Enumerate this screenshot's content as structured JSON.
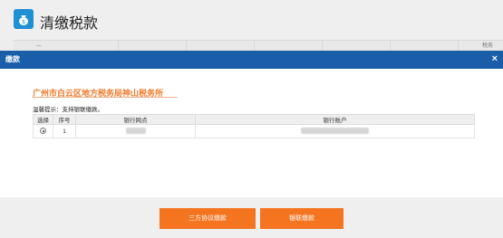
{
  "page": {
    "title": "清缴税款",
    "strip_left_text": "一",
    "strip_right_text": "税务"
  },
  "modal": {
    "title": "缴款",
    "close_glyph": "×",
    "org_name": "广州市白云区地方税务局神山税务所",
    "hint": "温馨提示：支持银联缴款。",
    "table": {
      "headers": [
        "选择",
        "序号",
        "银行网点",
        "银行账户"
      ],
      "rows": [
        {
          "selected": true,
          "index": "1",
          "bank_branch": "",
          "bank_account": ""
        }
      ]
    },
    "buttons": {
      "tripartite": "三方协议缴款",
      "unionpay": "银联缴款"
    }
  },
  "colors": {
    "header_blue": "#1a5da8",
    "accent_orange": "#f47420",
    "org_orange": "#f07a2a",
    "logo_blue": "#1f8fd6"
  },
  "icons": {
    "logo": "money-bag-icon",
    "close": "close-icon",
    "radio": "radio-checked-icon"
  }
}
